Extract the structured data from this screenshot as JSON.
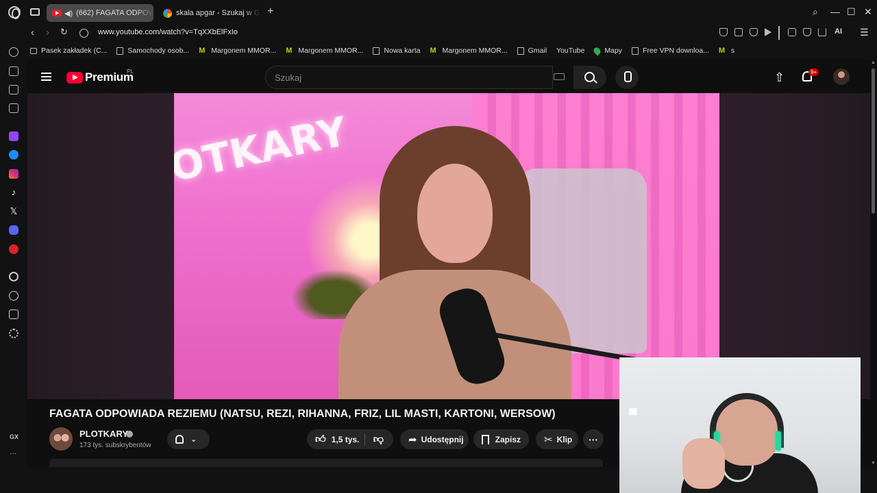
{
  "browser": {
    "tabs": [
      {
        "title": "(662) FAGATA ODPOW",
        "active": true,
        "audio": true
      },
      {
        "title": "skala apgar - Szukaj w Go",
        "active": false
      }
    ],
    "url": "www.youtube.com/watch?v=TqXXbElFxIo",
    "ai_label": "AI",
    "bookmarks": [
      {
        "label": "Pasek zakładek (C...",
        "icon": "folder-icon"
      },
      {
        "label": "Samochody osob...",
        "icon": "page-icon"
      },
      {
        "label": "Margonem MMOR...",
        "icon": "margonem-icon"
      },
      {
        "label": "Margonem MMOR...",
        "icon": "margonem-icon"
      },
      {
        "label": "Nowa karta",
        "icon": "page-icon"
      },
      {
        "label": "Margonem MMOR...",
        "icon": "margonem-icon"
      },
      {
        "label": "Gmail",
        "icon": "page-icon"
      },
      {
        "label": "YouTube",
        "icon": "youtube-icon"
      },
      {
        "label": "Mapy",
        "icon": "maps-pin-icon"
      },
      {
        "label": "Free VPN downloa...",
        "icon": "page-icon"
      },
      {
        "label": "s",
        "icon": "margonem-icon"
      }
    ],
    "sidebar_label": "GX",
    "sidebar_more": "···"
  },
  "youtube": {
    "brand": "Premium",
    "region": "PL",
    "search_placeholder": "Szukaj",
    "notifications": "9+",
    "video": {
      "neon_sign": "OTKARY",
      "title": "FAGATA ODPOWIADA REZIEMU (NATSU, REZI, RIHANNA, FRIZ, LIL MASTI, KARTONI, WERSOW)",
      "channel": "PLOTKARY",
      "subscribers": "173 tys. subskrybentów",
      "likes": "1,5 tys.",
      "share": "Udostępnij",
      "save": "Zapisz",
      "clip": "Klip",
      "more": "···"
    }
  },
  "colors": {
    "accent_red": "#ff0033",
    "background": "#0f0f0f",
    "pill": "#272727"
  }
}
